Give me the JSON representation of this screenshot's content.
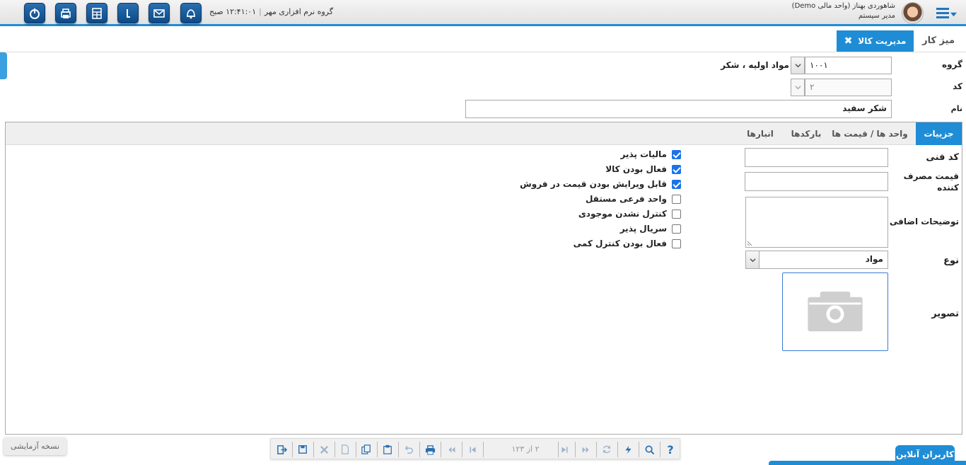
{
  "header": {
    "company": "گروه نرم افزاری مهر",
    "time": "۱۲:۴۱:۰۱ صبح",
    "user_name": "شاهوردی بهناز (واحد مالی Demo)",
    "user_role": "مدیر سیستم",
    "icons": [
      "power-icon",
      "printer-icon",
      "calculator-icon",
      "info-icon",
      "mail-icon",
      "bell-icon"
    ]
  },
  "tabs": {
    "desk": "میز کار",
    "active": "مدیریت کالا"
  },
  "form": {
    "group_label": "گروه",
    "group_code": "۱۰۰۱",
    "group_text": "مواد اولیه ، شکر",
    "code_label": "کد",
    "code_value": "۲",
    "name_label": "نام",
    "name_value": "شکر سفید"
  },
  "detail_tabs": [
    "جزییات",
    "واحد ها / قیمت ها",
    "بارکدها",
    "انبارها"
  ],
  "details": {
    "tech_code_label": "کد فنی",
    "consumer_price_label": "قیمت مصرف کننده",
    "extra_desc_label": "توضیحات اضافی",
    "type_label": "نوع",
    "type_value": "مواد",
    "image_label": "تصویر"
  },
  "checkboxes": [
    {
      "label": "مالیات پذیر",
      "checked": true
    },
    {
      "label": "فعال بودن کالا",
      "checked": true
    },
    {
      "label": "قابل ویرایش بودن قیمت در فروش",
      "checked": true
    },
    {
      "label": "واحد فرعی مستقل",
      "checked": false
    },
    {
      "label": "کنترل نشدن موجودی",
      "checked": false
    },
    {
      "label": "سریال پذیر",
      "checked": false
    },
    {
      "label": "فعال بودن کنترل کمی",
      "checked": false
    }
  ],
  "toolbar": {
    "pager": "۲ از ۱۲۳"
  },
  "footer": {
    "trial": "نسخه آزمایشی",
    "online_users": "کاربران آنلاین"
  },
  "colors": {
    "accent": "#1f8dd6",
    "icon_blue": "#0d4a86"
  }
}
